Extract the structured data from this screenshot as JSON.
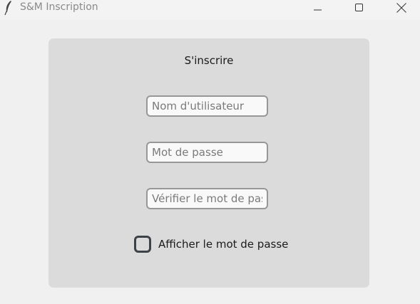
{
  "window": {
    "title": "S&M Inscription",
    "icon": "feather-icon"
  },
  "form": {
    "title": "S'inscrire",
    "username_placeholder": "Nom d'utilisateur",
    "password_placeholder": "Mot de passe",
    "verify_placeholder": "Vérifier le mot de passe",
    "show_password_label": "Afficher le mot de passe",
    "show_password_checked": false
  },
  "colors": {
    "window_bg": "#f0f0f0",
    "panel_bg": "#dbdbdb",
    "entry_border": "#979797",
    "checkbox_border": "#3d4249"
  }
}
